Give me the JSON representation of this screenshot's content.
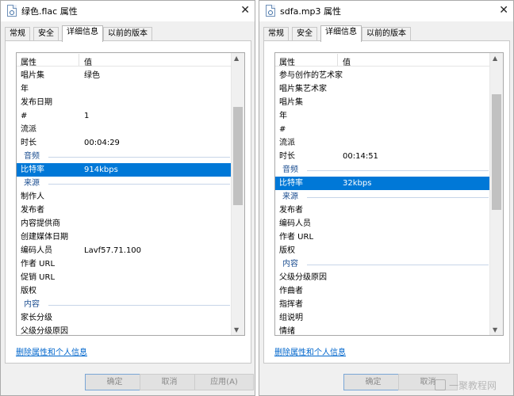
{
  "windows": [
    {
      "title": "绿色.flac 属性",
      "tabs": [
        "常规",
        "安全",
        "详细信息",
        "以前的版本"
      ],
      "active_tab": 2,
      "columns": [
        "属性",
        "值"
      ],
      "rows": [
        {
          "k": "唱片集",
          "v": "绿色"
        },
        {
          "k": "年",
          "v": ""
        },
        {
          "k": "发布日期",
          "v": ""
        },
        {
          "k": "#",
          "v": "1"
        },
        {
          "k": "流派",
          "v": ""
        },
        {
          "k": "时长",
          "v": "00:04:29"
        },
        {
          "k": "音频",
          "type": "group"
        },
        {
          "k": "比特率",
          "v": "914kbps",
          "selected": true
        },
        {
          "k": "来源",
          "type": "group"
        },
        {
          "k": "制作人",
          "v": ""
        },
        {
          "k": "发布者",
          "v": ""
        },
        {
          "k": "内容提供商",
          "v": ""
        },
        {
          "k": "创建媒体日期",
          "v": ""
        },
        {
          "k": "编码人员",
          "v": "Lavf57.71.100"
        },
        {
          "k": "作者 URL",
          "v": ""
        },
        {
          "k": "促销 URL",
          "v": ""
        },
        {
          "k": "版权",
          "v": ""
        },
        {
          "k": "内容",
          "type": "group"
        },
        {
          "k": "家长分级",
          "v": ""
        },
        {
          "k": "父级分级原因",
          "v": ""
        }
      ],
      "scroll_position": 0.35,
      "link": "删除属性和个人信息",
      "buttons": [
        "确定",
        "取消",
        "应用(A)"
      ]
    },
    {
      "title": "sdfa.mp3 属性",
      "tabs": [
        "常规",
        "安全",
        "详细信息",
        "以前的版本"
      ],
      "active_tab": 2,
      "columns": [
        "属性",
        "值"
      ],
      "rows": [
        {
          "k": "参与创作的艺术家",
          "v": ""
        },
        {
          "k": "唱片集艺术家",
          "v": ""
        },
        {
          "k": "唱片集",
          "v": ""
        },
        {
          "k": "年",
          "v": ""
        },
        {
          "k": "#",
          "v": ""
        },
        {
          "k": "流派",
          "v": ""
        },
        {
          "k": "时长",
          "v": "00:14:51"
        },
        {
          "k": "音频",
          "type": "group"
        },
        {
          "k": "比特率",
          "v": "32kbps",
          "selected": true
        },
        {
          "k": "来源",
          "type": "group"
        },
        {
          "k": "发布者",
          "v": ""
        },
        {
          "k": "编码人员",
          "v": ""
        },
        {
          "k": "作者 URL",
          "v": ""
        },
        {
          "k": "版权",
          "v": ""
        },
        {
          "k": "内容",
          "type": "group"
        },
        {
          "k": "父级分级原因",
          "v": ""
        },
        {
          "k": "作曲者",
          "v": ""
        },
        {
          "k": "指挥者",
          "v": ""
        },
        {
          "k": "组说明",
          "v": ""
        },
        {
          "k": "情绪",
          "v": ""
        }
      ],
      "scroll_position": 0.3,
      "link": "删除属性和个人信息",
      "buttons": [
        "确定",
        "取消"
      ]
    }
  ],
  "watermark": "一聚教程网"
}
